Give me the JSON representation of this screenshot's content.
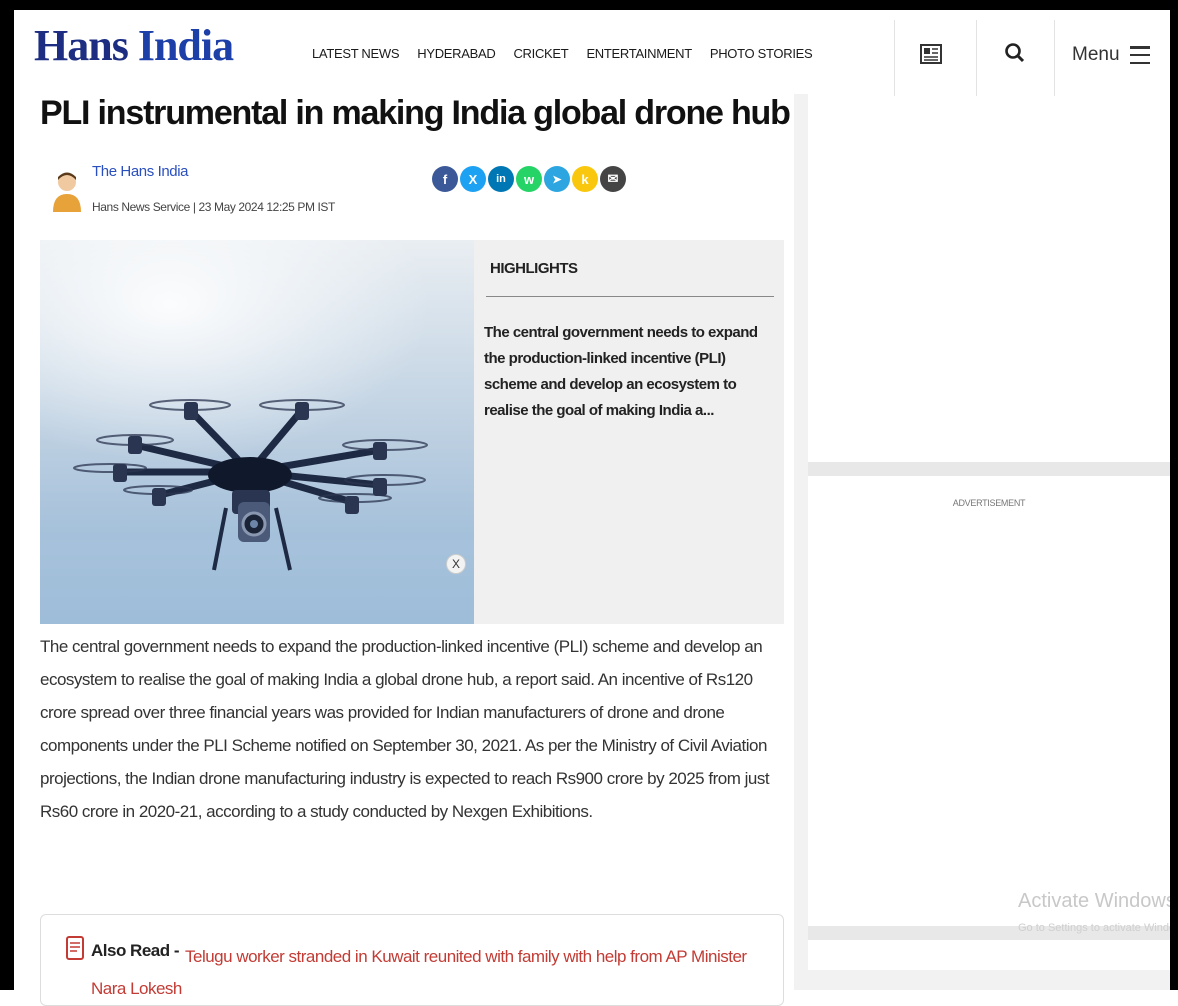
{
  "header": {
    "logo_text_1": "Hans",
    "logo_text_2": "India",
    "logo_tagline": "Hans News Service",
    "nav": [
      "LATEST NEWS",
      "HYDERABAD",
      "CRICKET",
      "ENTERTAINMENT",
      "PHOTO STORIES"
    ],
    "menu_label": "Menu"
  },
  "article": {
    "title": "PLI instrumental in making India global drone hub",
    "author": "The Hans India",
    "byline": "Hans News Service | 23 May 2024 12:25 PM IST",
    "highlights_title": "HIGHLIGHTS",
    "highlights_text": "The central government needs to expand the production-linked incentive (PLI) scheme and develop an ecosystem to realise the goal of making India a...",
    "close_label": "X",
    "body": "The central government needs to expand the production-linked incentive (PLI) scheme and develop an ecosystem to realise the goal of making India a global drone hub, a report said. An incentive of Rs120 crore spread over three financial years was provided for Indian manufacturers of drone and drone components under the PLI Scheme notified on September 30, 2021. As per the Ministry of Civil Aviation projections, the Indian drone manufacturing industry is expected to reach Rs900 crore by 2025 from just Rs60 crore in 2020-21, according to a study conducted by Nexgen Exhibitions.",
    "also_read_label": "Also Read - ",
    "also_read_link": "Telugu worker stranded in Kuwait reunited with family with help from AP Minister Nara Lokesh"
  },
  "share_icons": [
    {
      "name": "facebook-icon",
      "glyph": "f",
      "color": "#3b5998"
    },
    {
      "name": "x-twitter-icon",
      "glyph": "X",
      "color": "#1da1f2"
    },
    {
      "name": "linkedin-icon",
      "glyph": "in",
      "color": "#0077b5"
    },
    {
      "name": "whatsapp-icon",
      "glyph": "w",
      "color": "#25d366"
    },
    {
      "name": "telegram-icon",
      "glyph": "➤",
      "color": "#2ca5e0"
    },
    {
      "name": "koo-icon",
      "glyph": "k",
      "color": "#f9c80e"
    },
    {
      "name": "email-icon",
      "glyph": "✉",
      "color": "#444444"
    }
  ],
  "sidebar": {
    "advertisement_label": "ADVERTISEMENT",
    "watermark_title": "Activate Windows",
    "watermark_sub": "Go to Settings to activate Windows."
  },
  "colors": {
    "brand": "#1c2d82",
    "link": "#2a4fbf",
    "also_read": "#c23b34"
  }
}
